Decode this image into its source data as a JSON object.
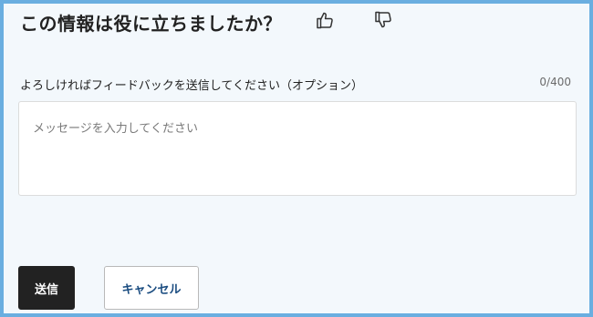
{
  "feedback": {
    "title": "この情報は役に立ちましたか？",
    "thumb_up_icon": "thumbs-up-icon",
    "thumb_down_icon": "thumbs-down-icon",
    "label": "よろしければフィードバックを送信してください（オプション）",
    "char_count": "0/400",
    "input_value": "",
    "input_placeholder": "メッセージを入力してください",
    "submit_label": "送信",
    "cancel_label": "キャンセル"
  },
  "colors": {
    "frame_border": "#6aaee0",
    "background": "#f3f8fc",
    "submit_bg": "#222222",
    "cancel_text": "#1a4c80"
  }
}
